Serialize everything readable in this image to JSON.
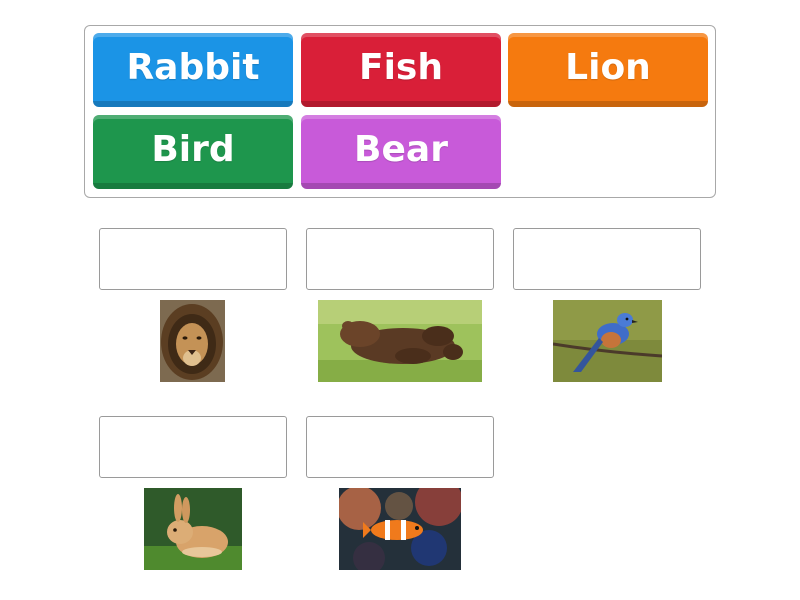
{
  "tiles": {
    "rabbit": {
      "label": "Rabbit",
      "color": "#1b94e6"
    },
    "fish": {
      "label": "Fish",
      "color": "#d91f38"
    },
    "lion": {
      "label": "Lion",
      "color": "#f57a0f"
    },
    "bird": {
      "label": "Bird",
      "color": "#1e964d"
    },
    "bear": {
      "label": "Bear",
      "color": "#c85ad9"
    }
  },
  "targets": [
    {
      "image": "lion-photo",
      "answer": ""
    },
    {
      "image": "bear-photo",
      "answer": ""
    },
    {
      "image": "bird-photo",
      "answer": ""
    },
    {
      "image": "rabbit-photo",
      "answer": ""
    },
    {
      "image": "fish-photo",
      "answer": ""
    }
  ]
}
